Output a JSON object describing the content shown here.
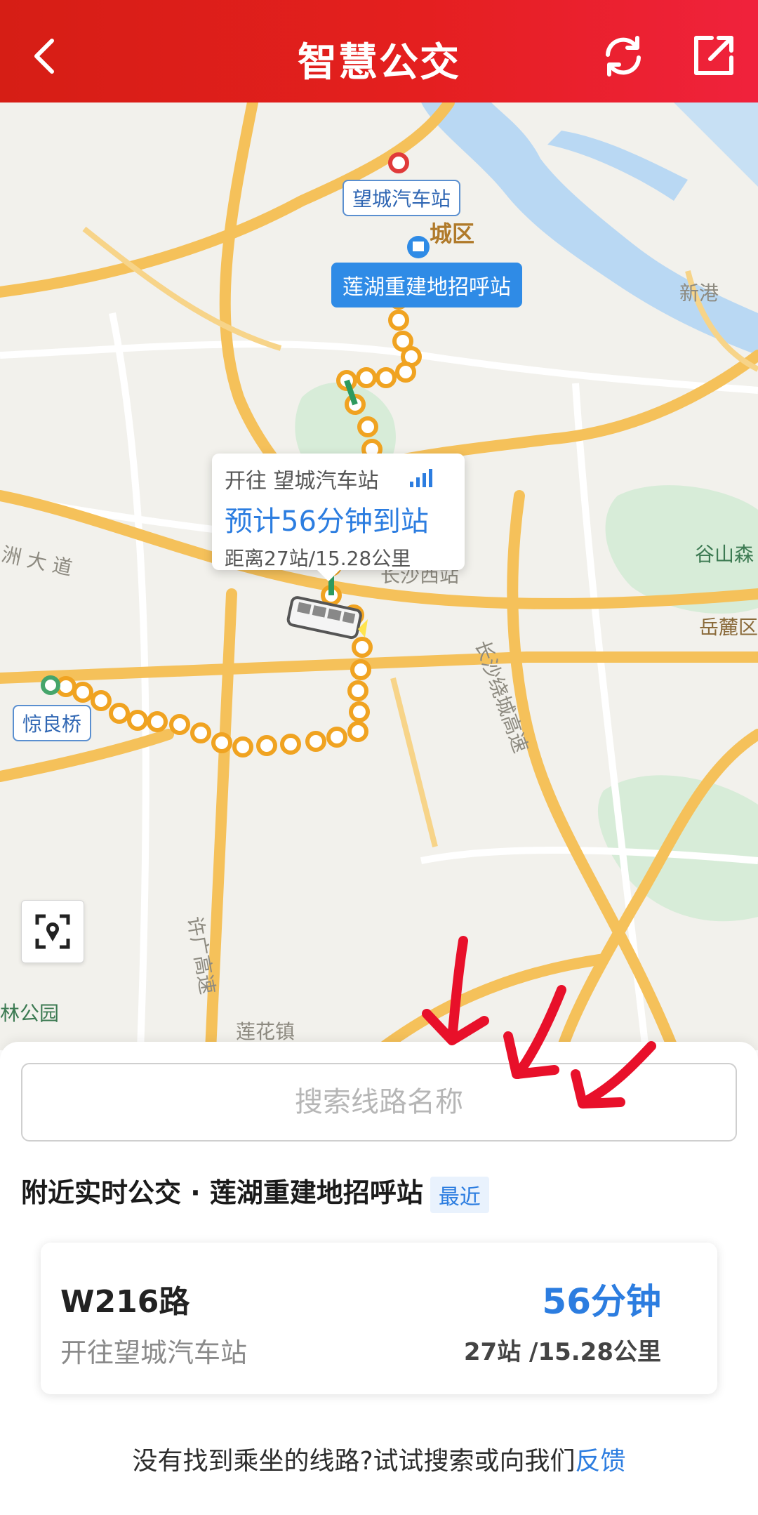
{
  "header": {
    "title": "智慧公交",
    "back_icon": "chevron-left-icon",
    "refresh_icon": "refresh-icon",
    "share_icon": "share-out-icon",
    "bg_color": "#e41f1f"
  },
  "map": {
    "place_labels": [
      "城区",
      "新港",
      "谷山森",
      "岳麓区",
      "洲 大 道",
      "长沙西站",
      "长沙绕城高速",
      "许广高速",
      "莲花镇",
      "林公园"
    ],
    "stops": {
      "terminal": "望城汽车站",
      "current": "莲湖重建地招呼站",
      "origin": "惊良桥"
    },
    "bubble": {
      "direction": "开往 望城汽车站",
      "eta": "预计56分钟到站",
      "distance": "距离27站/15.28公里"
    },
    "route_color": "#f0a321",
    "congestion_color": "#2e9a5f"
  },
  "sheet": {
    "search_placeholder": "搜索线路名称",
    "nearby_title": "附近实时公交 · 莲湖重建地招呼站",
    "nearby_badge": "最近",
    "route": {
      "name": "W216路",
      "destination": "开往望城汽车站",
      "eta": "56分钟",
      "stops_distance": "27站 /15.28公里"
    },
    "hint_text": "没有找到乘坐的线路?试试搜索或向我们",
    "hint_link": "反馈"
  }
}
